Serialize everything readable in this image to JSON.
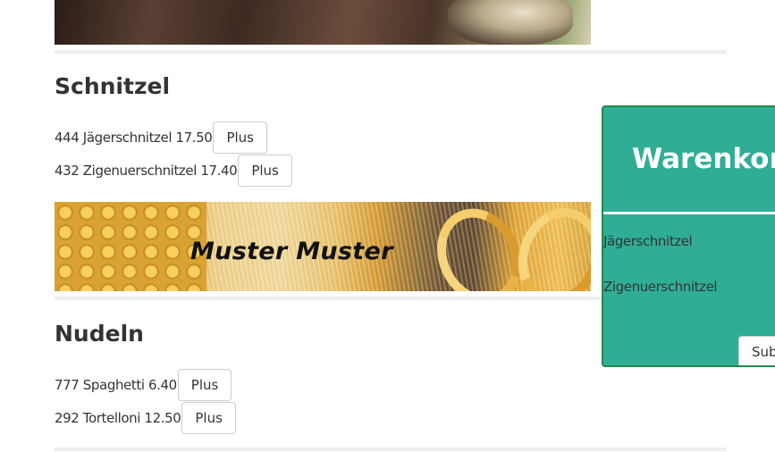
{
  "banners": {
    "pasta_text": "Muster Muster"
  },
  "sections": [
    {
      "title": "Schnitzel",
      "items": [
        {
          "text": "444 Jägerschnitzel 17.50",
          "button": "Plus"
        },
        {
          "text": "432 Zigenuerschnitzel 17.40",
          "button": "Plus"
        }
      ]
    },
    {
      "title": "Nudeln",
      "items": [
        {
          "text": "777 Spaghetti 6.40",
          "button": "Plus"
        },
        {
          "text": "292 Tortelloni 12.50",
          "button": "Plus"
        }
      ]
    }
  ],
  "cart": {
    "title": "Warenkorb",
    "items": [
      "Jägerschnitzel",
      "Zigenuerschnitzel"
    ],
    "submit_label": "Submit"
  },
  "colors": {
    "cart_background": "#2fae95",
    "cart_border": "#1f8a4a"
  }
}
